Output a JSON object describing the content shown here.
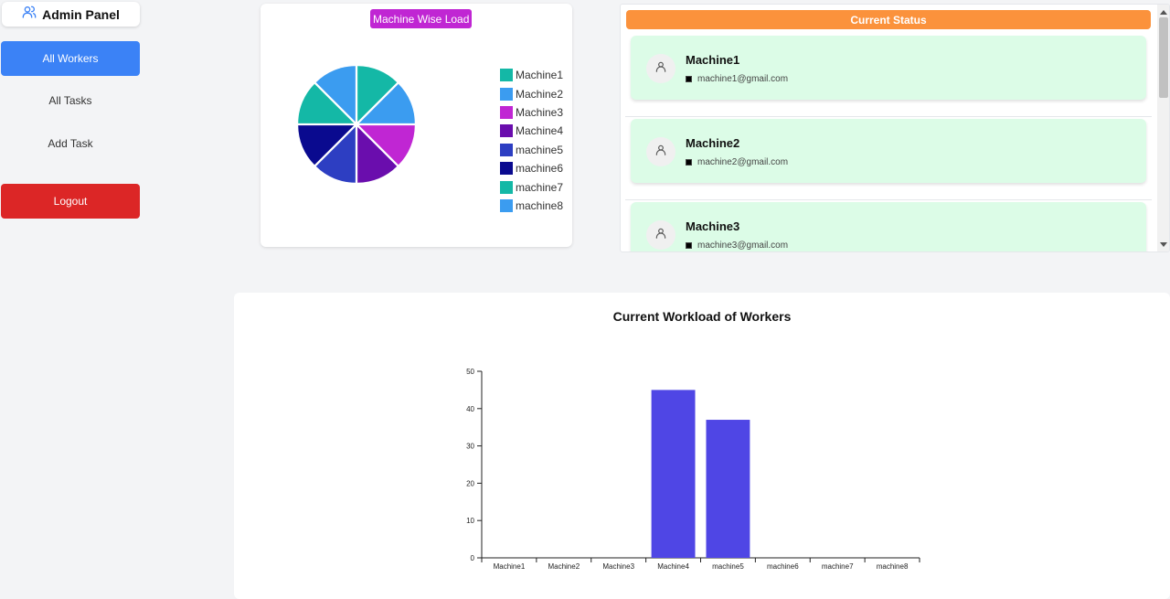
{
  "sidebar": {
    "brand": "Admin Panel",
    "items": [
      {
        "label": "All Workers"
      },
      {
        "label": "All Tasks"
      },
      {
        "label": "Add Task"
      }
    ],
    "logout": "Logout"
  },
  "pie": {
    "title": "Machine Wise Load",
    "legend": [
      {
        "label": "Machine1",
        "color": "#14b8a6"
      },
      {
        "label": "Machine2",
        "color": "#3b9cf0"
      },
      {
        "label": "Machine3",
        "color": "#c026d3"
      },
      {
        "label": "Machine4",
        "color": "#6a0dad"
      },
      {
        "label": "machine5",
        "color": "#2d3ec2"
      },
      {
        "label": "machine6",
        "color": "#0a0a8f"
      },
      {
        "label": "machine7",
        "color": "#14b8a6"
      },
      {
        "label": "machine8",
        "color": "#3b9cf0"
      }
    ]
  },
  "status": {
    "title": "Current Status",
    "machines": [
      {
        "name": "Machine1",
        "email": "machine1@gmail.com"
      },
      {
        "name": "Machine2",
        "email": "machine2@gmail.com"
      },
      {
        "name": "Machine3",
        "email": "machine3@gmail.com"
      }
    ]
  },
  "chart_data": {
    "type": "bar",
    "title": "Current Workload of Workers",
    "categories": [
      "Machine1",
      "Machine2",
      "Machine3",
      "Machine4",
      "machine5",
      "machine6",
      "machine7",
      "machine8"
    ],
    "values": [
      0,
      0,
      0,
      45,
      37,
      0,
      0,
      0
    ],
    "yticks": [
      0,
      10,
      20,
      30,
      40,
      50
    ],
    "ylim": [
      0,
      50
    ],
    "bar_color": "#4f46e5",
    "grid": false
  },
  "colors": {
    "primary": "#3b82f6",
    "danger": "#dc2626",
    "status_header": "#fb923c",
    "card_green": "#dcfce7",
    "pie_title_bg": "#c026d3"
  }
}
